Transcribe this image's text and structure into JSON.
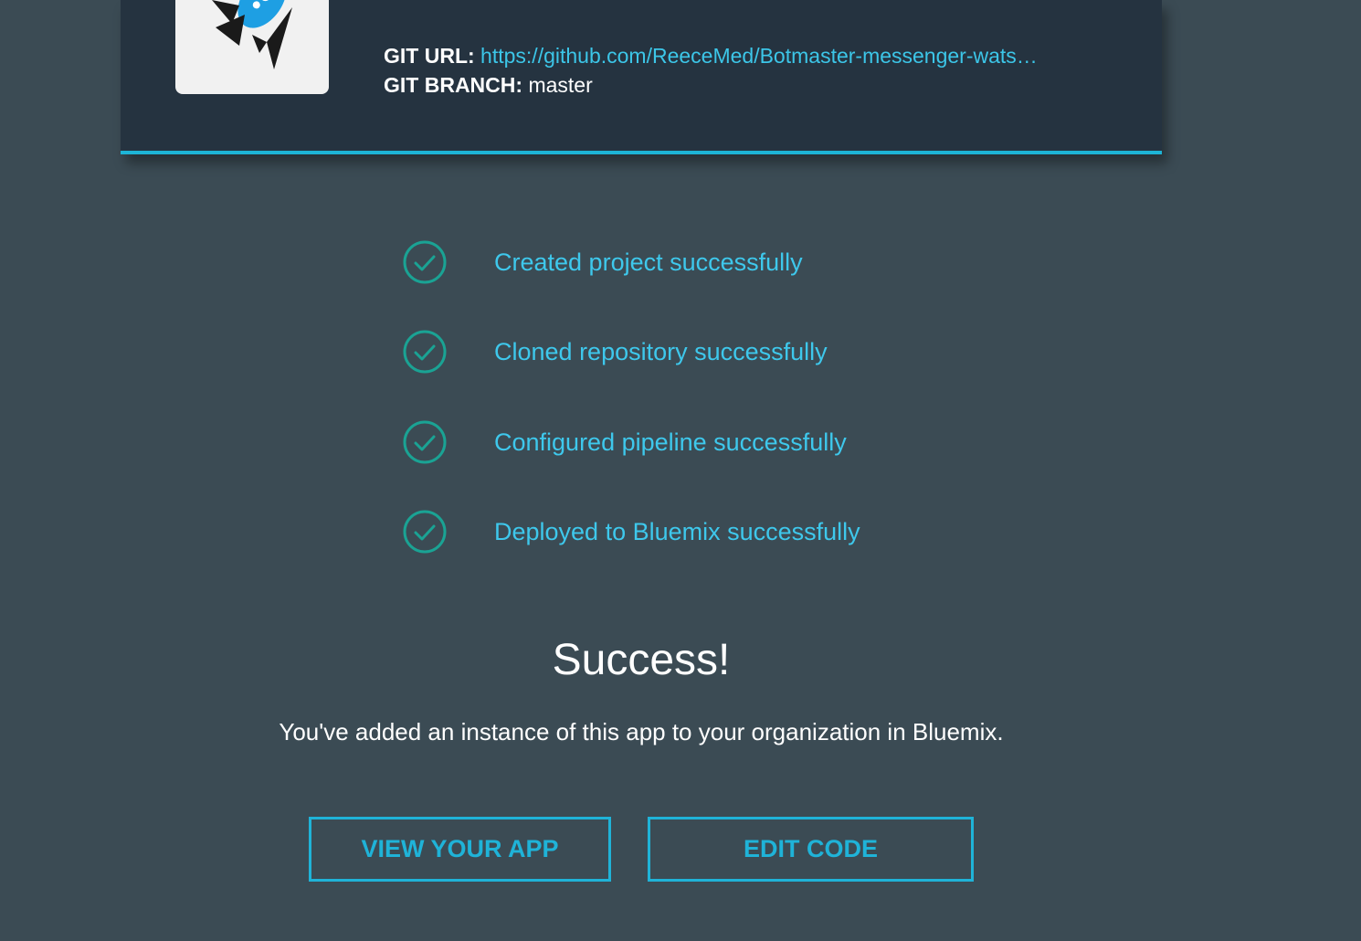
{
  "header": {
    "git_url_label": "GIT URL:",
    "git_url_value": "https://github.com/ReeceMed/Botmaster-messenger-wats…",
    "git_branch_label": "GIT BRANCH:",
    "git_branch_value": "master",
    "logo_icon": "rocket-icon"
  },
  "steps": [
    {
      "label": "Created project successfully",
      "icon": "check-circle-icon"
    },
    {
      "label": "Cloned repository successfully",
      "icon": "check-circle-icon"
    },
    {
      "label": "Configured pipeline successfully",
      "icon": "check-circle-icon"
    },
    {
      "label": "Deployed to Bluemix successfully",
      "icon": "check-circle-icon"
    }
  ],
  "result": {
    "title": "Success!",
    "description": "You've added an instance of this app to your organization in Bluemix."
  },
  "actions": {
    "view_app_label": "VIEW YOUR APP",
    "edit_code_label": "EDIT CODE"
  },
  "colors": {
    "background": "#3b4b54",
    "header_background": "#253340",
    "accent": "#1db4d6",
    "link": "#3cc6e8",
    "check": "#1aa394"
  }
}
